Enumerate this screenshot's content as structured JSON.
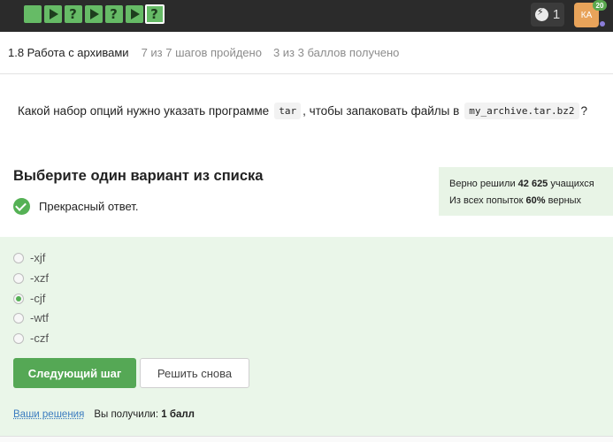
{
  "topbar": {
    "steps": [
      {
        "type": "text",
        "symbol": "",
        "icon": "text-step-icon",
        "status": "passed"
      },
      {
        "type": "video",
        "symbol": "",
        "icon": "play-icon",
        "status": "passed"
      },
      {
        "type": "quiz",
        "symbol": "?",
        "icon": "question-icon",
        "status": "passed"
      },
      {
        "type": "video",
        "symbol": "",
        "icon": "play-icon",
        "status": "passed"
      },
      {
        "type": "quiz",
        "symbol": "?",
        "icon": "question-icon",
        "status": "passed"
      },
      {
        "type": "video",
        "symbol": "",
        "icon": "play-icon",
        "status": "passed"
      },
      {
        "type": "quiz",
        "symbol": "?",
        "icon": "question-icon",
        "status": "current"
      }
    ],
    "energy_count": "1",
    "avatar_initials": "КА",
    "avatar_badge": "20"
  },
  "lesson": {
    "title": "1.8 Работа с архивами",
    "progress": "7 из 7 шагов пройдено",
    "score": "3 из 3 баллов  получено"
  },
  "question": {
    "text_before": "Какой набор опций нужно указать программе",
    "program": "tar",
    "text_middle": ", чтобы запаковать файлы в",
    "archive": "my_archive.tar.bz2",
    "text_after": "?"
  },
  "section_title": "Выберите один вариант из списка",
  "feedback": "Прекрасный ответ.",
  "stats": {
    "line1_prefix": "Верно решили",
    "line1_count": "42 625",
    "line1_suffix": "учащихся",
    "line2_prefix": "Из всех попыток",
    "line2_percent": "60%",
    "line2_suffix": "верных"
  },
  "options": [
    "-xjf",
    "-xzf",
    "-cjf",
    "-wtf",
    "-czf"
  ],
  "selected_option": "-cjf",
  "buttons": {
    "next": "Следующий шаг",
    "retry": "Решить снова"
  },
  "footer": {
    "solutions_link": "Ваши решения",
    "received_prefix": "Вы получили:",
    "received_value": "1 балл"
  },
  "colors": {
    "topbar": "#2b2b2b",
    "accent_green": "#55a855",
    "panel_bg": "#eaf6e9",
    "link": "#3a7bbf"
  }
}
